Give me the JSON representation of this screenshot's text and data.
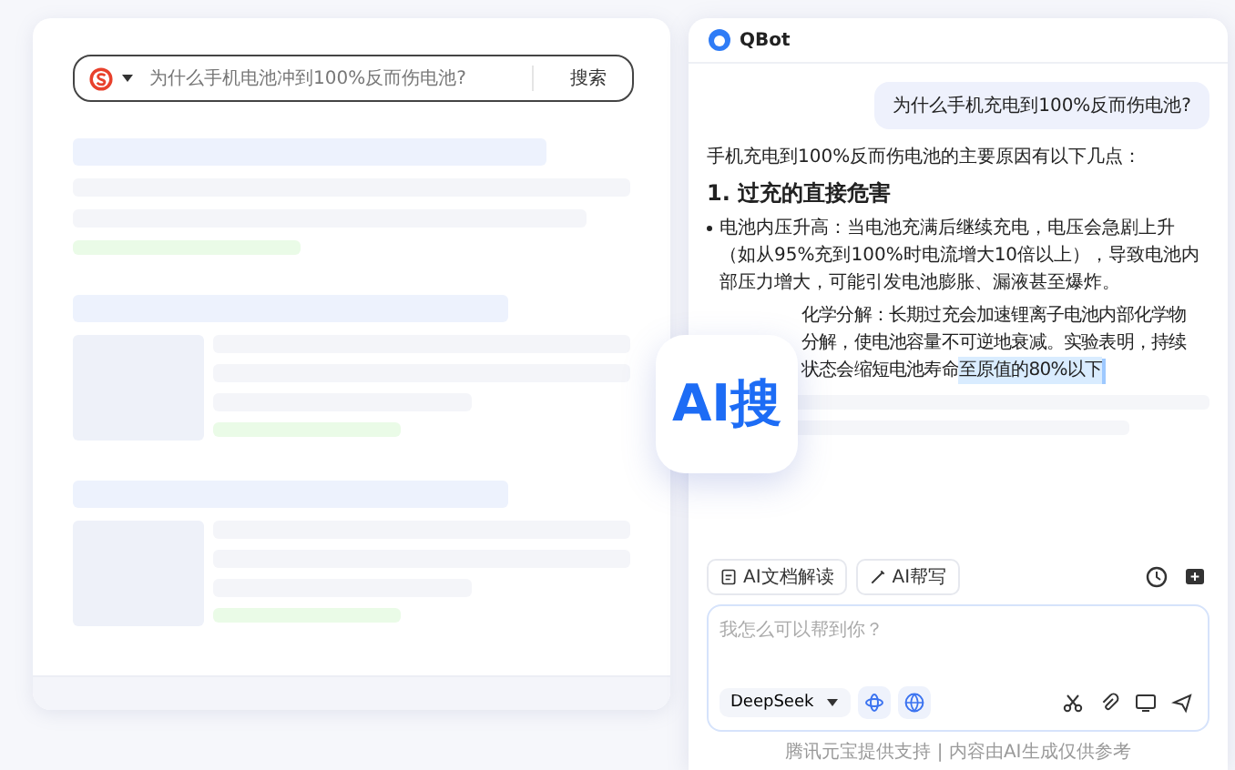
{
  "search_bar": {
    "value": "为什么手机电池冲到100%反而伤电池?",
    "button": "搜索"
  },
  "results": [
    {
      "kind": "plain"
    },
    {
      "kind": "with_thumbnail"
    },
    {
      "kind": "with_thumbnail"
    }
  ],
  "badge": {
    "label": "AI搜"
  },
  "assistant": {
    "title": "QBot",
    "user_message": "为什么手机充电到100%反而伤电池?",
    "intro": "手机充电到100%反而伤电池的主要原因有以下几点：",
    "heading": "1. 过充的直接危害",
    "bullets": [
      {
        "kind": "paragraph",
        "text": "电池内压升高：当电池充满后继续充电，电压会急剧上升（如从95%充到100%时电流增大10倍以上），导致电池内部压力增大，可能引发电池膨胀、漏液甚至爆炸。"
      },
      {
        "kind": "partly_covered",
        "lines": [
          "化学分解：长期过充会加速锂离子电池内部化学物",
          "分解，使电池容量不可逆地衰减。实验表明，持续"
        ],
        "last_line": "状态会缩短电池寿命",
        "highlight": "至原值的80%以下"
      }
    ],
    "tools": [
      {
        "label": "AI文档解读"
      },
      {
        "label": "AI帮写"
      }
    ],
    "input": {
      "placeholder": "我怎么可以帮到你？",
      "model": "DeepSeek"
    },
    "footer": "腾讯元宝提供支持 | 内容由AI生成仅供参考"
  }
}
